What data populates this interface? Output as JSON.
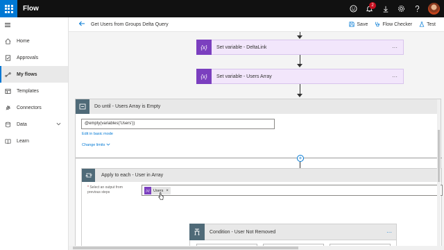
{
  "app": {
    "title": "Flow",
    "notification_count": "2"
  },
  "topbar": {
    "icons": [
      "emoji-icon",
      "bell-icon",
      "download-icon",
      "gear-icon",
      "help-icon"
    ]
  },
  "sidebar": {
    "items": [
      {
        "label": "Home",
        "icon": "home-icon"
      },
      {
        "label": "Approvals",
        "icon": "approvals-icon"
      },
      {
        "label": "My flows",
        "icon": "flows-icon",
        "active": true
      },
      {
        "label": "Templates",
        "icon": "templates-icon"
      },
      {
        "label": "Connectors",
        "icon": "connectors-icon"
      },
      {
        "label": "Data",
        "icon": "data-icon"
      },
      {
        "label": "Learn",
        "icon": "learn-icon"
      }
    ]
  },
  "commandbar": {
    "breadcrumb": "Get Users from Groups Delta Query",
    "save": "Save",
    "flow_checker": "Flow Checker",
    "test": "Test"
  },
  "flow": {
    "step1": {
      "title": "Set variable - DeltaLink",
      "icon_text": "{x}"
    },
    "step2": {
      "title": "Set variable - Users Array",
      "icon_text": "{x}"
    },
    "do_until": {
      "title": "Do until - Users Array is Empty",
      "expression": "@empty(variables('Users'))",
      "edit_link": "Edit in basic mode",
      "change_limits": "Change limits"
    },
    "apply_each": {
      "title": "Apply to each - User in Array",
      "field_label": "Select an output from previous steps",
      "required_mark": "*",
      "token_label": "Users",
      "token_icon_text": "{x}"
    },
    "condition": {
      "title": "Condition - User Not Removed"
    }
  },
  "colors": {
    "accent": "#0078d4",
    "variable_purple": "#7b3fbf",
    "control_slate": "#4f6a78",
    "topbar": "#111111"
  }
}
